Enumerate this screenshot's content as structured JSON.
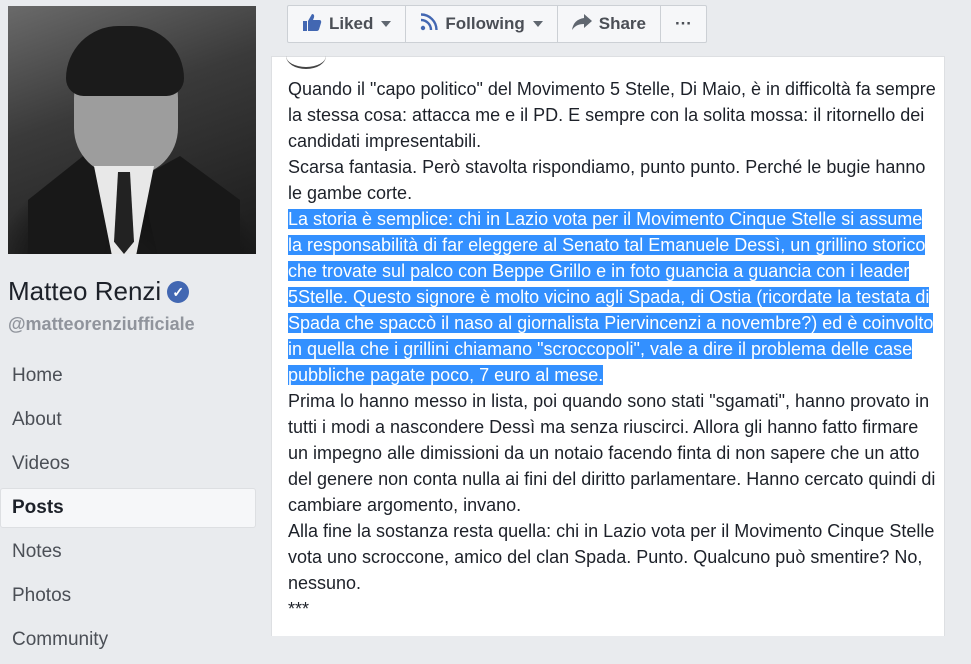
{
  "page": {
    "name": "Matteo Renzi",
    "handle": "@matteorenziufficiale"
  },
  "nav": {
    "items": [
      {
        "label": "Home"
      },
      {
        "label": "About"
      },
      {
        "label": "Videos"
      },
      {
        "label": "Posts",
        "active": true
      },
      {
        "label": "Notes"
      },
      {
        "label": "Photos"
      },
      {
        "label": "Community"
      }
    ]
  },
  "actions": {
    "liked": "Liked",
    "following": "Following",
    "share": "Share",
    "more": "···"
  },
  "post": {
    "para1": "Quando il \"capo politico\" del Movimento 5 Stelle, Di Maio, è in difficoltà fa sempre la stessa cosa: attacca me e il PD. E sempre con la solita mossa: il ritornello dei candidati impresentabili.",
    "para2": "Scarsa fantasia. Però stavolta rispondiamo, punto punto. Perché le bugie hanno le gambe corte.",
    "highlighted": "La storia è semplice: chi in Lazio vota per il Movimento Cinque Stelle si assume la responsabilità di far eleggere al Senato tal Emanuele Dessì, un grillino storico che trovate sul palco con Beppe Grillo e in foto guancia a guancia con i leader 5Stelle. Questo signore è molto vicino agli Spada, di Ostia (ricordate la testata di Spada che spaccò il naso al giornalista Piervincenzi a novembre?) ed è coinvolto in quella che i grillini chiamano \"scroccopoli\", vale a dire il problema delle case pubbliche pagate poco, 7 euro al mese.",
    "para3": "Prima lo hanno messo in lista, poi quando sono stati \"sgamati\", hanno provato in tutti i modi a nascondere Dessì ma senza riuscirci. Allora gli hanno fatto firmare un impegno alle dimissioni da un notaio facendo finta di non sapere che un atto del genere non conta nulla ai fini del diritto parlamentare. Hanno cercato quindi di cambiare argomento, invano.",
    "para4": "Alla fine la sostanza resta quella: chi in Lazio vota per il Movimento Cinque Stelle vota uno scroccone, amico del clan Spada. Punto. Qualcuno può smentire? No, nessuno.",
    "para5": "***"
  },
  "colors": {
    "facebook_blue": "#4267b2",
    "selection": "#3390ff",
    "background": "#e9ebee"
  }
}
